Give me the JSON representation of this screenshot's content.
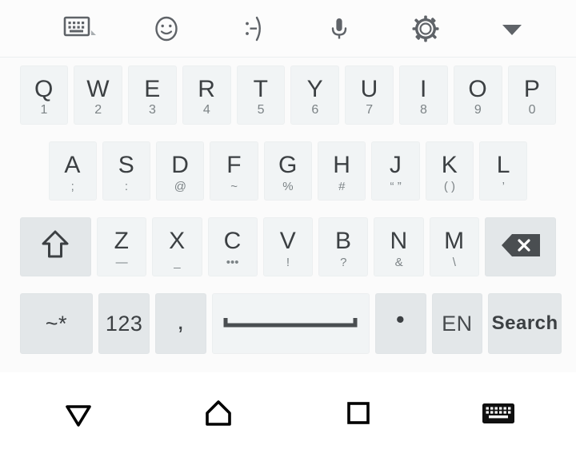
{
  "toolbar": {
    "items": [
      {
        "name": "keyboard-switch-icon",
        "label": "Keyboard layout"
      },
      {
        "name": "emoji-icon",
        "label": "Emoji"
      },
      {
        "name": "emoticon-icon",
        "label": ":-)"
      },
      {
        "name": "microphone-icon",
        "label": "Voice input"
      },
      {
        "name": "settings-gear-icon",
        "label": "Settings"
      },
      {
        "name": "chevron-down-icon",
        "label": "Hide toolbar"
      }
    ]
  },
  "keyboard": {
    "row1": [
      {
        "main": "Q",
        "hint": "1"
      },
      {
        "main": "W",
        "hint": "2"
      },
      {
        "main": "E",
        "hint": "3"
      },
      {
        "main": "R",
        "hint": "4"
      },
      {
        "main": "T",
        "hint": "5"
      },
      {
        "main": "Y",
        "hint": "6"
      },
      {
        "main": "U",
        "hint": "7"
      },
      {
        "main": "I",
        "hint": "8"
      },
      {
        "main": "O",
        "hint": "9"
      },
      {
        "main": "P",
        "hint": "0"
      }
    ],
    "row2": [
      {
        "main": "A",
        "hint": ";"
      },
      {
        "main": "S",
        "hint": ":"
      },
      {
        "main": "D",
        "hint": "@"
      },
      {
        "main": "F",
        "hint": "~"
      },
      {
        "main": "G",
        "hint": "%"
      },
      {
        "main": "H",
        "hint": "#"
      },
      {
        "main": "J",
        "hint": "“ ”"
      },
      {
        "main": "K",
        "hint": "( )"
      },
      {
        "main": "L",
        "hint": "’"
      }
    ],
    "row3": {
      "shift": {
        "name": "shift-key",
        "label": "Shift"
      },
      "letters": [
        {
          "main": "Z",
          "hint": "—"
        },
        {
          "main": "X",
          "hint": "_"
        },
        {
          "main": "C",
          "hint": "•••"
        },
        {
          "main": "V",
          "hint": "!"
        },
        {
          "main": "B",
          "hint": "?"
        },
        {
          "main": "N",
          "hint": "&"
        },
        {
          "main": "M",
          "hint": "\\"
        }
      ],
      "backspace": {
        "name": "backspace-key",
        "label": "Backspace"
      }
    },
    "row4": {
      "symbols": "~*",
      "numbers": "123",
      "comma": ",",
      "space": "",
      "period": "•",
      "language": "EN",
      "action": "Search"
    }
  },
  "navbar": {
    "items": [
      {
        "name": "back-down-icon",
        "label": "Back"
      },
      {
        "name": "home-icon",
        "label": "Home"
      },
      {
        "name": "recents-icon",
        "label": "Recent apps"
      },
      {
        "name": "keyboard-indicator-icon",
        "label": "Keyboard active"
      }
    ]
  },
  "colors": {
    "key_bg": "#f1f4f5",
    "key_fn_bg": "#e3e7e9",
    "key_text": "#3c4043",
    "hint_text": "#7c8386",
    "toolbar_bg": "#fcfcfc",
    "keyboard_bg": "#fbfbfb",
    "navbar_bg": "#ffffff",
    "icon": "#5f6368",
    "nav_icon": "#000000"
  }
}
